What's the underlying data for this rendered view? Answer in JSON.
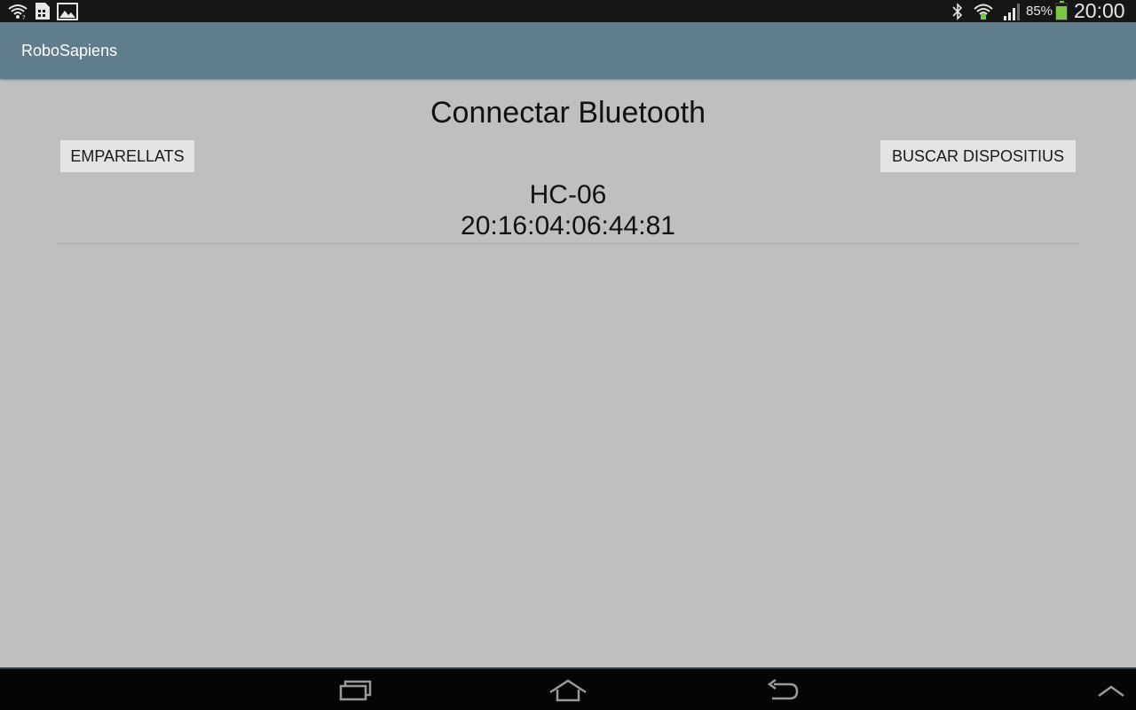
{
  "status_bar": {
    "battery_percent_text": "85%",
    "battery_level": 0.85,
    "clock": "20:00",
    "left_icons": [
      "wifi-notification-icon",
      "sim-card-icon",
      "gallery-icon"
    ],
    "right_icons": [
      "bluetooth-icon",
      "wifi-signal-icon",
      "cell-signal-icon"
    ],
    "battery_color": "#7ac943"
  },
  "action_bar": {
    "title": "RoboSapiens",
    "color": "#607d8b"
  },
  "main": {
    "title": "Connectar Bluetooth",
    "paired_button": "EMPARELLATS",
    "scan_button": "BUSCAR DISPOSITIUS",
    "devices": [
      {
        "name": "HC-06",
        "address": "20:16:04:06:44:81"
      }
    ]
  },
  "nav_bar": {
    "buttons": [
      "recent-apps-icon",
      "home-icon",
      "back-icon",
      "expand-up-icon"
    ]
  }
}
